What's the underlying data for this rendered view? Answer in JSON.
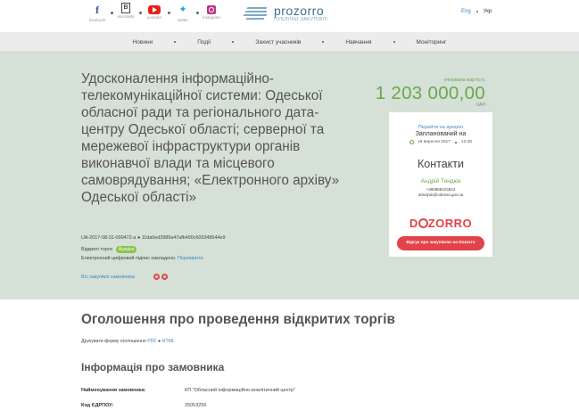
{
  "header": {
    "social": [
      {
        "icon": "facebook-icon",
        "label": "facebook",
        "glyph": "f"
      },
      {
        "icon": "vkontakte-icon",
        "label": "vkontakte",
        "glyph": "B"
      },
      {
        "icon": "youtube-icon",
        "label": "youtube",
        "glyph": ""
      },
      {
        "icon": "twitter-icon",
        "label": "twitter",
        "glyph": "🐦"
      },
      {
        "icon": "instagram-icon",
        "label": "instagram",
        "glyph": ""
      }
    ],
    "logo_name": "prozorro",
    "logo_sub": "ПУБЛІЧНІ ЗАКУПІВЛІ",
    "lang_en": "Eng",
    "lang_uk": "Укр"
  },
  "nav": [
    "Новини",
    "Події",
    "Захист учасників",
    "Навчання",
    "Моніторинг"
  ],
  "tender": {
    "title": "Удосконалення інформаційно-телекомунікаційної системи: Одеської обласної ради та регіонального дата-центру Одеської області; серверної та мережевої інфраструктури органів виконавчої влади та місцевого самоврядування; «Електронного архіву» Одеської області»",
    "id": "UA-2017-08-31-000472-a",
    "hash": "11da0ed3989a47afb490c600348644e9",
    "procedure": "Відкриті торги",
    "procedure_tag": "Аукціон",
    "sign_text": "Електронний цифровий підпис накладено.",
    "sign_link": "Перевірити",
    "all_tenders": "Всі закупівлі замовника"
  },
  "price": {
    "label": "очікувана вартість",
    "value": "1 203 000,00",
    "currency": "UAH"
  },
  "auction": {
    "link": "Перейти на аукціон",
    "status": "Запланований на",
    "date": "19 вересня 2017",
    "time": "12:28"
  },
  "contacts": {
    "heading": "Контакти",
    "name": "Андрій Тиндюк",
    "phone": "+380958423922",
    "email": "atindyuk@odessa.gov.ua"
  },
  "dozorro": {
    "logo": "DOZORRO",
    "button": "Відгук про закупівлю на Dozorro"
  },
  "announcement": {
    "title": "Оголошення про проведення відкритих торгів",
    "print_text": "Друкувати форму оголошення",
    "pdf": "PDF",
    "html": "HTML"
  },
  "customer": {
    "title": "Інформація про замовника",
    "rows": [
      {
        "label": "Найменування замовника:",
        "value": "КП \"Обласний інформаційно-аналітичний центр\""
      },
      {
        "label": "Код ЄДРПОУ:",
        "value": "25053256"
      }
    ]
  },
  "colors": {
    "accent_green": "#6aa84f",
    "link_blue": "#3b8ac4",
    "dozorro_red": "#e2434b",
    "hero_bg": "#d5e0d6"
  }
}
